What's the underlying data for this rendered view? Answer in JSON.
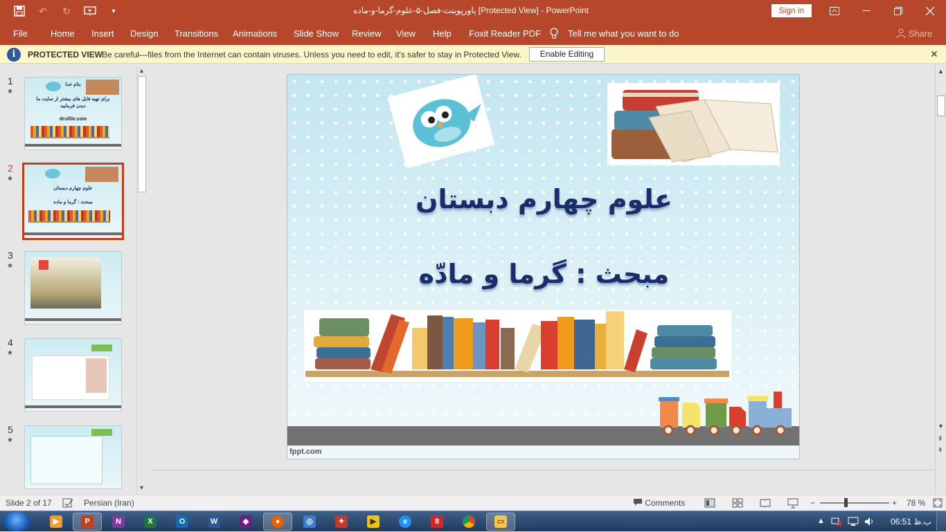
{
  "window": {
    "title": "پاورپوینت-فصل-۵-علوم-گرما-و-ماده [Protected View]  -  PowerPoint",
    "sign_in": "Sign in"
  },
  "menu": {
    "file": "File",
    "home": "Home",
    "insert": "Insert",
    "design": "Design",
    "transitions": "Transitions",
    "animations": "Animations",
    "slide_show": "Slide Show",
    "review": "Review",
    "view": "View",
    "help": "Help",
    "foxit": "Foxit Reader PDF",
    "tell_me": "Tell me what you want to do",
    "share": "Share"
  },
  "protected_view": {
    "label": "PROTECTED VIEW",
    "message": "Be careful—files from the Internet can contain viruses. Unless you need to edit, it's safer to stay in Protected View.",
    "enable_button": "Enable Editing"
  },
  "thumbnails": [
    {
      "number": "1",
      "lines": [
        "بنام خدا",
        "برای تهیه فایل های بیشتر از سایت ما",
        "دیدن فرمایید",
        "drsifile.com"
      ]
    },
    {
      "number": "2",
      "lines": [
        "علوم چهارم دبستان",
        "مبحث : گرما و ماده"
      ]
    },
    {
      "number": "3",
      "lines": []
    },
    {
      "number": "4",
      "lines": []
    },
    {
      "number": "5",
      "lines": []
    }
  ],
  "slide": {
    "title": "علوم چهارم دبستان",
    "subtitle": "مبحث : گرما و مادّه",
    "footer": "fppt.com"
  },
  "status": {
    "slide_info": "Slide 2 of 17",
    "language": "Persian (Iran)",
    "comments": "Comments",
    "zoom": "78 %"
  },
  "taskbar": {
    "clock": "06:51 ب.ظ"
  },
  "colors": {
    "accent": "#b7472a",
    "active_thumb": "#c43e1c",
    "slide_title": "#1a2d6b"
  },
  "icons": {
    "save": "save-icon",
    "undo": "undo-icon",
    "redo": "redo-icon",
    "present": "start-from-beginning-icon",
    "customize": "customize-qat-icon",
    "lightbulb": "lightbulb-icon",
    "shield": "shield-info-icon"
  }
}
